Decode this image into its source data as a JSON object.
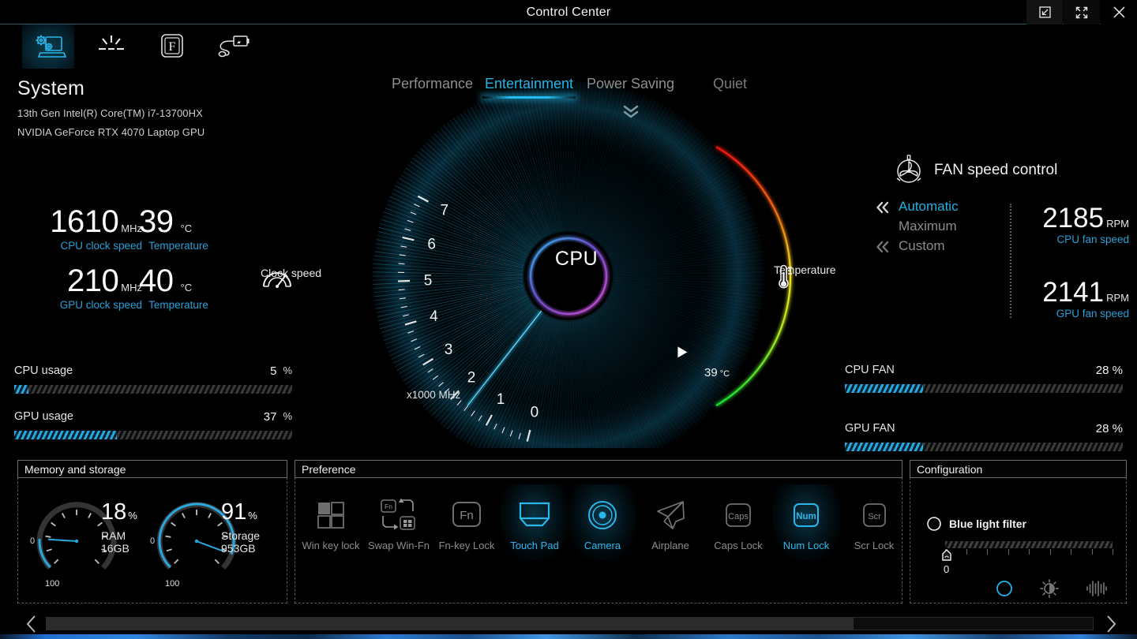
{
  "window": {
    "title": "Control Center",
    "controls": [
      {
        "name": "restore-window-button",
        "icon": "restore-icon"
      },
      {
        "name": "maximize-window-button",
        "icon": "expand-icon"
      },
      {
        "name": "close-window-button",
        "icon": "close-icon"
      }
    ]
  },
  "icon_tabs": [
    {
      "name": "system-tab",
      "icon": "laptop-gears-icon",
      "active": true
    },
    {
      "name": "keyboard-backlight-tab",
      "icon": "keyboard-light-icon",
      "active": false
    },
    {
      "name": "function-key-tab",
      "icon": "fn-key-icon",
      "active": false
    },
    {
      "name": "power-tab",
      "icon": "power-plug-battery-icon",
      "active": false
    }
  ],
  "system": {
    "heading": "System",
    "cpu": "13th Gen Intel(R) Core(TM) i7-13700HX",
    "gpu": "NVIDIA GeForce RTX 4070 Laptop GPU"
  },
  "mode_tabs": [
    {
      "label": "Performance",
      "active": false
    },
    {
      "label": "Entertainment",
      "active": true
    },
    {
      "label": "Power Saving",
      "active": false
    },
    {
      "label": "Quiet",
      "active": false
    }
  ],
  "expand_icon": "chevron-double-down-icon",
  "readouts": {
    "cpu_clock": {
      "value": "1610",
      "unit": "MHz",
      "caption": "CPU clock speed"
    },
    "cpu_temp": {
      "value": "39",
      "unit": "°C",
      "caption": "Temperature"
    },
    "gpu_clock": {
      "value": "210",
      "unit": "MHz",
      "caption": "GPU clock speed"
    },
    "gpu_temp": {
      "value": "40",
      "unit": "°C",
      "caption": "Temperature"
    }
  },
  "usage_bars": [
    {
      "label": "CPU usage",
      "value": "5",
      "percent_sign": "%",
      "percent": 5
    },
    {
      "label": "GPU usage",
      "value": "37",
      "percent_sign": "%",
      "percent": 37
    }
  ],
  "fan_bars": [
    {
      "label": "CPU FAN",
      "value": "28 %",
      "percent": 28
    },
    {
      "label": "GPU FAN",
      "value": "28 %",
      "percent": 28
    }
  ],
  "gauge": {
    "center_label": "CPU",
    "scale_unit": "x1000 MHz",
    "ticks": [
      "0",
      "1",
      "2",
      "3",
      "4",
      "5",
      "6",
      "7"
    ],
    "needle_value": 1.61,
    "scale_max": 7,
    "clock_legend": "Clock speed",
    "clock_legend_icon": "speedometer-icon",
    "temp_legend": "Temperature",
    "temp_legend_icon": "thermometer-icon",
    "temp_value": "39",
    "temp_unit": "°C",
    "temp_marker_icon": "triangle-left-icon"
  },
  "fan_control": {
    "heading": "FAN speed control",
    "heading_icon": "fan-icon",
    "modes": [
      {
        "label": "Automatic",
        "active": true,
        "icon": "chevron-double-left-icon"
      },
      {
        "label": "Maximum",
        "active": false,
        "icon": ""
      },
      {
        "label": "Custom",
        "active": false,
        "icon": "chevron-double-left-icon"
      }
    ],
    "readings": [
      {
        "value": "2185",
        "unit": "RPM",
        "caption": "CPU fan speed"
      },
      {
        "value": "2141",
        "unit": "RPM",
        "caption": "GPU fan speed"
      }
    ]
  },
  "memory_panel": {
    "title": "Memory and storage",
    "dials": [
      {
        "percent": "18",
        "percent_sign": "%",
        "name": "RAM",
        "size": "16GB",
        "min": "0",
        "max": "100",
        "value": 18
      },
      {
        "percent": "91",
        "percent_sign": "%",
        "name": "Storage",
        "size": "953GB",
        "min": "0",
        "max": "100",
        "value": 91
      }
    ]
  },
  "preference_panel": {
    "title": "Preference",
    "items": [
      {
        "label": "Win key lock",
        "icon": "windows-key-lock-icon",
        "on": false
      },
      {
        "label": "Swap Win-Fn",
        "icon": "swap-win-fn-icon",
        "on": false
      },
      {
        "label": "Fn-key Lock",
        "icon": "fn-key-lock-icon",
        "on": false
      },
      {
        "label": "Touch Pad",
        "icon": "touchpad-icon",
        "on": true
      },
      {
        "label": "Camera",
        "icon": "camera-icon",
        "on": true
      },
      {
        "label": "Airplane",
        "icon": "airplane-icon",
        "on": false
      },
      {
        "label": "Caps Lock",
        "icon": "caps-lock-key-icon",
        "on": false
      },
      {
        "label": "Num Lock",
        "icon": "num-lock-key-icon",
        "on": true
      },
      {
        "label": "Scr Lock",
        "icon": "scroll-lock-key-icon",
        "on": false
      }
    ]
  },
  "configuration_panel": {
    "title": "Configuration",
    "blue_light_filter": {
      "label": "Blue light filter",
      "icon": "half-moon-icon",
      "slider_value": "0",
      "slider_percent": 0
    },
    "mode_icons": [
      {
        "name": "blue-light-filter-icon",
        "active": true
      },
      {
        "name": "brightness-contrast-icon",
        "active": false
      },
      {
        "name": "audio-waveform-icon",
        "active": false
      }
    ]
  },
  "scrollbar": {
    "left_arrow": "chevron-left-icon",
    "right_arrow": "chevron-right-icon"
  },
  "colors": {
    "accent": "#29a8e0",
    "accent_caption": "#2a9fd6",
    "background": "#000000",
    "text": "#f0f0f0",
    "muted": "#8b8b8b"
  }
}
